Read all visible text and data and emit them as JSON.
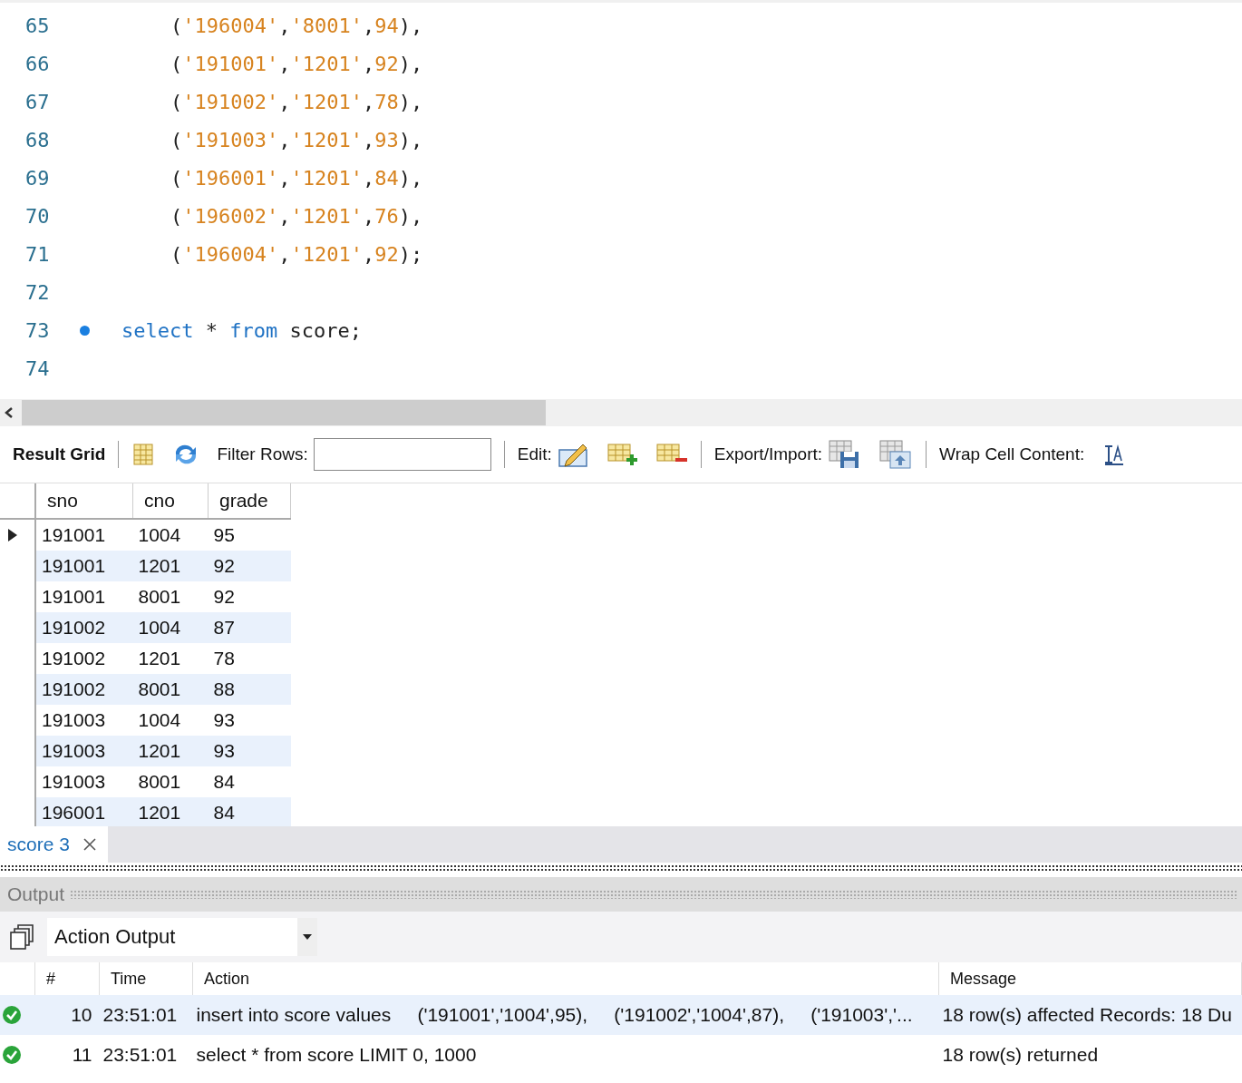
{
  "editor": {
    "lines": [
      {
        "number": "65",
        "marker": false,
        "kind": "value_row",
        "tokens": [
          {
            "kind": "punct",
            "text": "("
          },
          {
            "kind": "string",
            "text": "'196004'"
          },
          {
            "kind": "punct",
            "text": ","
          },
          {
            "kind": "string",
            "text": "'8001'"
          },
          {
            "kind": "punct",
            "text": ","
          },
          {
            "kind": "number",
            "text": "94"
          },
          {
            "kind": "punct",
            "text": "),"
          }
        ]
      },
      {
        "number": "66",
        "marker": false,
        "kind": "value_row",
        "tokens": [
          {
            "kind": "punct",
            "text": "("
          },
          {
            "kind": "string",
            "text": "'191001'"
          },
          {
            "kind": "punct",
            "text": ","
          },
          {
            "kind": "string",
            "text": "'1201'"
          },
          {
            "kind": "punct",
            "text": ","
          },
          {
            "kind": "number",
            "text": "92"
          },
          {
            "kind": "punct",
            "text": "),"
          }
        ]
      },
      {
        "number": "67",
        "marker": false,
        "kind": "value_row",
        "tokens": [
          {
            "kind": "punct",
            "text": "("
          },
          {
            "kind": "string",
            "text": "'191002'"
          },
          {
            "kind": "punct",
            "text": ","
          },
          {
            "kind": "string",
            "text": "'1201'"
          },
          {
            "kind": "punct",
            "text": ","
          },
          {
            "kind": "number",
            "text": "78"
          },
          {
            "kind": "punct",
            "text": "),"
          }
        ]
      },
      {
        "number": "68",
        "marker": false,
        "kind": "value_row",
        "tokens": [
          {
            "kind": "punct",
            "text": "("
          },
          {
            "kind": "string",
            "text": "'191003'"
          },
          {
            "kind": "punct",
            "text": ","
          },
          {
            "kind": "string",
            "text": "'1201'"
          },
          {
            "kind": "punct",
            "text": ","
          },
          {
            "kind": "number",
            "text": "93"
          },
          {
            "kind": "punct",
            "text": "),"
          }
        ]
      },
      {
        "number": "69",
        "marker": false,
        "kind": "value_row",
        "tokens": [
          {
            "kind": "punct",
            "text": "("
          },
          {
            "kind": "string",
            "text": "'196001'"
          },
          {
            "kind": "punct",
            "text": ","
          },
          {
            "kind": "string",
            "text": "'1201'"
          },
          {
            "kind": "punct",
            "text": ","
          },
          {
            "kind": "number",
            "text": "84"
          },
          {
            "kind": "punct",
            "text": "),"
          }
        ]
      },
      {
        "number": "70",
        "marker": false,
        "kind": "value_row",
        "tokens": [
          {
            "kind": "punct",
            "text": "("
          },
          {
            "kind": "string",
            "text": "'196002'"
          },
          {
            "kind": "punct",
            "text": ","
          },
          {
            "kind": "string",
            "text": "'1201'"
          },
          {
            "kind": "punct",
            "text": ","
          },
          {
            "kind": "number",
            "text": "76"
          },
          {
            "kind": "punct",
            "text": "),"
          }
        ]
      },
      {
        "number": "71",
        "marker": false,
        "kind": "value_row",
        "tokens": [
          {
            "kind": "punct",
            "text": "("
          },
          {
            "kind": "string",
            "text": "'196004'"
          },
          {
            "kind": "punct",
            "text": ","
          },
          {
            "kind": "string",
            "text": "'1201'"
          },
          {
            "kind": "punct",
            "text": ","
          },
          {
            "kind": "number",
            "text": "92"
          },
          {
            "kind": "punct",
            "text": ");"
          }
        ]
      },
      {
        "number": "72",
        "marker": false
      },
      {
        "number": "73",
        "marker": true,
        "kind": "statement",
        "tokens": [
          {
            "kind": "keyword",
            "text": "select"
          },
          {
            "kind": "punct",
            "text": " * "
          },
          {
            "kind": "keyword",
            "text": "from"
          },
          {
            "kind": "punct",
            "text": " score;"
          }
        ]
      },
      {
        "number": "74",
        "marker": false
      }
    ]
  },
  "toolbar": {
    "result_grid": "Result Grid",
    "filter_label": "Filter Rows:",
    "edit_label": "Edit:",
    "export_label": "Export/Import:",
    "wrap_label": "Wrap Cell Content:"
  },
  "grid": {
    "columns": [
      "sno",
      "cno",
      "grade"
    ],
    "rows": [
      {
        "selected": true,
        "cells": [
          "191001",
          "1004",
          "95"
        ]
      },
      {
        "selected": false,
        "cells": [
          "191001",
          "1201",
          "92"
        ]
      },
      {
        "selected": false,
        "cells": [
          "191001",
          "8001",
          "92"
        ]
      },
      {
        "selected": false,
        "cells": [
          "191002",
          "1004",
          "87"
        ]
      },
      {
        "selected": false,
        "cells": [
          "191002",
          "1201",
          "78"
        ]
      },
      {
        "selected": false,
        "cells": [
          "191002",
          "8001",
          "88"
        ]
      },
      {
        "selected": false,
        "cells": [
          "191003",
          "1004",
          "93"
        ]
      },
      {
        "selected": false,
        "cells": [
          "191003",
          "1201",
          "93"
        ]
      },
      {
        "selected": false,
        "cells": [
          "191003",
          "8001",
          "84"
        ]
      },
      {
        "selected": false,
        "cells": [
          "196001",
          "1201",
          "84"
        ]
      }
    ]
  },
  "result_tabs": [
    {
      "label": "score 3",
      "selected": true
    }
  ],
  "output": {
    "title": "Output",
    "dropdown": "Action Output",
    "columns": [
      "#",
      "Time",
      "Action",
      "Message"
    ],
    "rows": [
      {
        "kind": "success",
        "number": "10",
        "time": "23:51:01",
        "action": "insert into score values     ('191001','1004',95),     ('191002','1004',87),     ('191003','...",
        "message": "18 row(s) affected Records: 18  Du"
      },
      {
        "kind": "success",
        "number": "11",
        "time": "23:51:01",
        "action": "select * from score LIMIT 0, 1000",
        "message": "18 row(s) returned"
      }
    ]
  }
}
